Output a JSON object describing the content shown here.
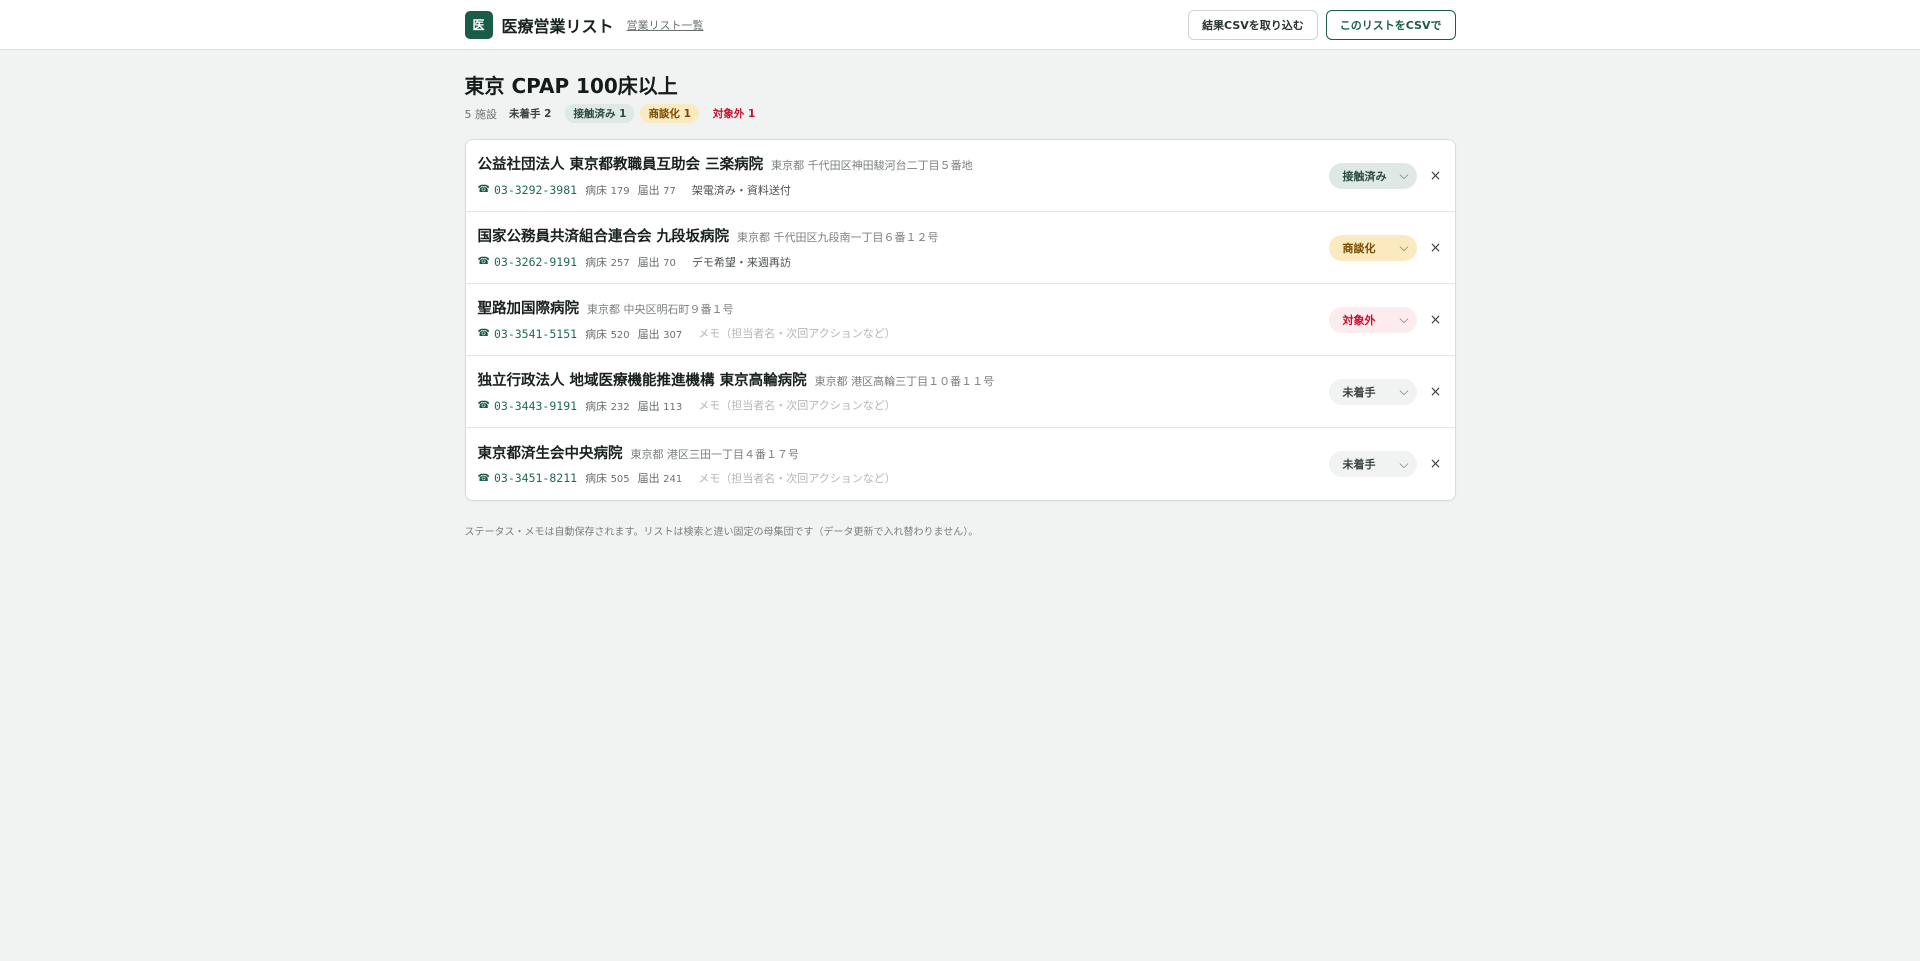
{
  "header": {
    "logo_char": "医",
    "app_title": "医療営業リスト",
    "nav_link": "営業リスト一覧",
    "import_button": "結果CSVを取り込む",
    "export_button": "このリストをCSVで"
  },
  "page": {
    "title": "東京 CPAP 100床以上",
    "count_value": "5",
    "count_unit": "施設",
    "chips": {
      "none": "未着手 2",
      "contacted": "接触済み 1",
      "deal": "商談化 1",
      "out": "対象外 1"
    }
  },
  "labels": {
    "beds": "病床",
    "filings": "届出",
    "memo_placeholder": "メモ（担当者名・次回アクションなど）",
    "phone_icon": "☎",
    "chevron": "⌵",
    "remove": "×"
  },
  "rows": [
    {
      "name": "公益社団法人 東京都教職員互助会 三楽病院",
      "address": "東京都 千代田区神田駿河台二丁目５番地",
      "phone": "03-3292-3981",
      "beds": "179",
      "filings": "77",
      "memo": "架電済み・資料送付",
      "status": "接触済み"
    },
    {
      "name": "国家公務員共済組合連合会 九段坂病院",
      "address": "東京都 千代田区九段南一丁目６番１２号",
      "phone": "03-3262-9191",
      "beds": "257",
      "filings": "70",
      "memo": "デモ希望・来週再訪",
      "status": "商談化"
    },
    {
      "name": "聖路加国際病院",
      "address": "東京都 中央区明石町９番１号",
      "phone": "03-3541-5151",
      "beds": "520",
      "filings": "307",
      "memo": "",
      "status": "対象外"
    },
    {
      "name": "独立行政法人 地域医療機能推進機構 東京高輪病院",
      "address": "東京都 港区高輪三丁目１０番１１号",
      "phone": "03-3443-9191",
      "beds": "232",
      "filings": "113",
      "memo": "",
      "status": "未着手"
    },
    {
      "name": "東京都済生会中央病院",
      "address": "東京都 港区三田一丁目４番１７号",
      "phone": "03-3451-8211",
      "beds": "505",
      "filings": "241",
      "memo": "",
      "status": "未着手"
    }
  ],
  "footnote": "ステータス・メモは自動保存されます。リストは検索と違い固定の母集団です（データ更新で入れ替わりません）。",
  "colors": {
    "accent": "#1b5c48",
    "background": "#f1f3f2",
    "contacted": "#dfe8e4",
    "deal": "#fbe9bf",
    "out": "#c8102e"
  }
}
